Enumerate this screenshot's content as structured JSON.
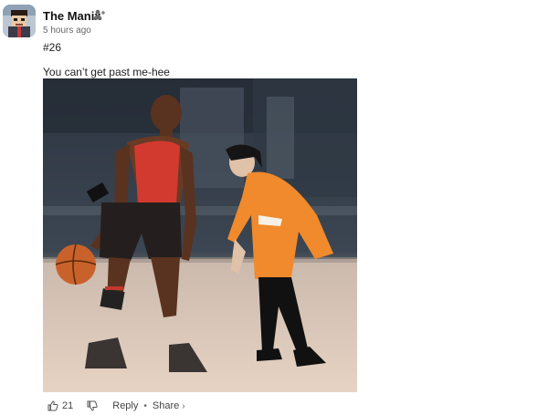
{
  "post": {
    "author": "The Manix",
    "timestamp": "5 hours ago",
    "tag": "#26",
    "caption": "You can’t get past me-hee"
  },
  "actions": {
    "like_count": "21",
    "reply_label": "Reply",
    "separator": "•",
    "share_label": "Share",
    "share_chevron": "›"
  },
  "icons": {
    "like": "thumbs-up-icon",
    "dislike": "thumbs-down-icon",
    "follow": "add-person-icon"
  },
  "colors": {
    "text": "#1a1a1a",
    "muted": "#666666",
    "jersey": "#e0463a",
    "jacket": "#f08a2c"
  }
}
